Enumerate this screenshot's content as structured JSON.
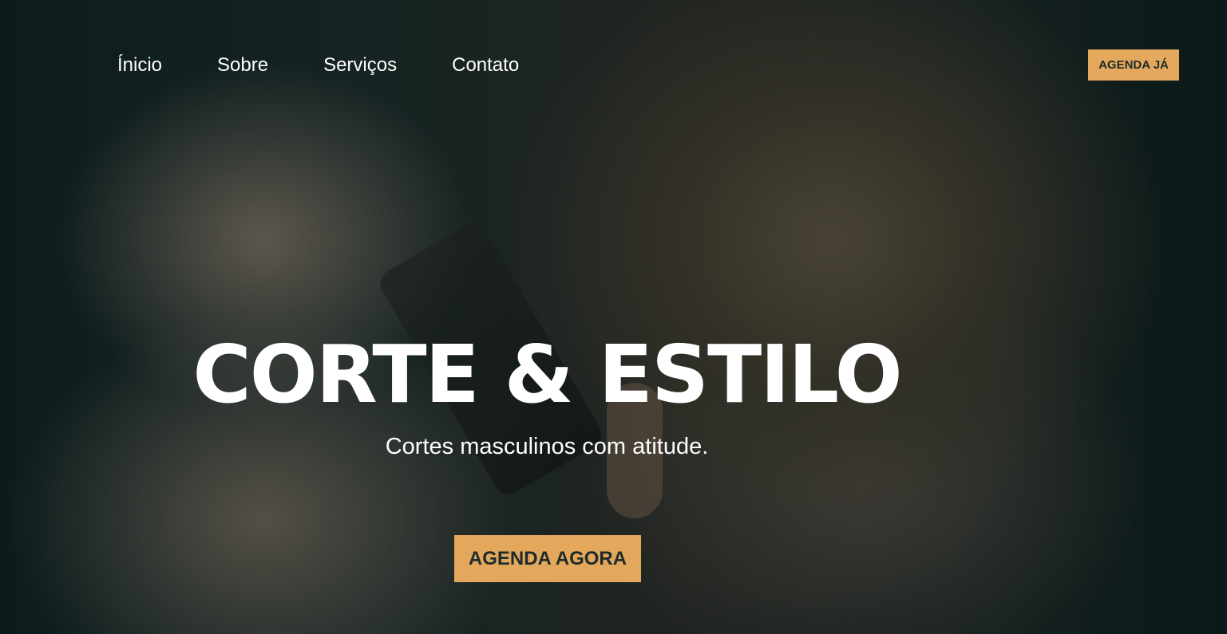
{
  "nav": {
    "items": [
      {
        "label": "Ínicio"
      },
      {
        "label": "Sobre"
      },
      {
        "label": "Serviços"
      },
      {
        "label": "Contato"
      }
    ],
    "cta_label": "AGENDA JÁ"
  },
  "hero": {
    "title": "CORTE & ESTILO",
    "subtitle": "Cortes masculinos com atitude.",
    "cta_label": "AGENDA AGORA"
  },
  "colors": {
    "accent": "#e4a85c",
    "dark_text": "#1d2b2a",
    "text": "#ffffff"
  }
}
